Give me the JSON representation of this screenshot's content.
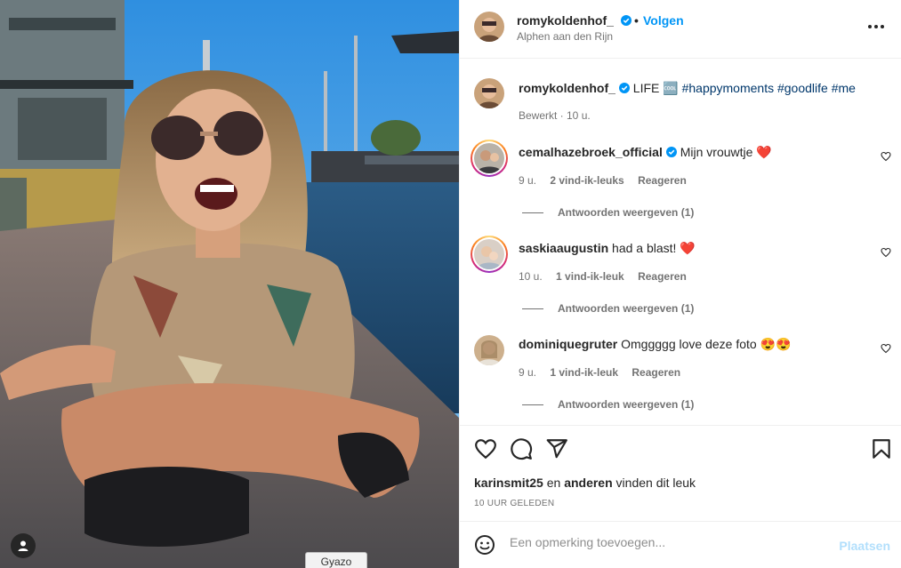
{
  "post": {
    "username": "romykoldenhof_",
    "follow_label": "Volgen",
    "location": "Alphen aan den Rijn",
    "caption_text": "LIFE",
    "caption_emoji": "🆒",
    "caption_tags": "#happymoments #goodlife #me",
    "caption_meta": "Bewerkt · 10 u."
  },
  "comments": [
    {
      "username": "cemalhazebroek_official",
      "text": "Mijn vrouwtje ❤️",
      "time": "9 u.",
      "likes": "2 vind-ik-leuks",
      "reply_label": "Reageren",
      "view_replies": "Antwoorden weergeven (1)"
    },
    {
      "username": "saskiaaugustin",
      "text": "had a blast! ❤️",
      "time": "10 u.",
      "likes": "1 vind-ik-leuk",
      "reply_label": "Reageren",
      "view_replies": "Antwoorden weergeven (1)"
    },
    {
      "username": "dominiquegruter",
      "text": "Omggggg love deze foto 😍😍",
      "time": "9 u.",
      "likes": "1 vind-ik-leuk",
      "reply_label": "Reageren",
      "view_replies": "Antwoorden weergeven (1)"
    }
  ],
  "liked_by": {
    "user": "karinsmit25",
    "connector": "en",
    "others": "anderen",
    "suffix": "vinden dit leuk"
  },
  "time_ago": "10 UUR GELEDEN",
  "comment_box": {
    "placeholder": "Een opmerking toevoegen...",
    "post_label": "Plaatsen"
  },
  "overlay": {
    "gyazo_label": "Gyazo"
  },
  "icons": {
    "verified": "verified-badge-icon",
    "more": "more-options-icon",
    "heart": "heart-icon",
    "comment": "comment-icon",
    "share": "share-icon",
    "save": "bookmark-icon",
    "emoji": "emoji-icon",
    "user_tag": "user-tag-icon"
  },
  "colors": {
    "accent": "#0095f6",
    "post_disabled": "#b2dffc",
    "text": "#262626",
    "muted": "#737373"
  }
}
